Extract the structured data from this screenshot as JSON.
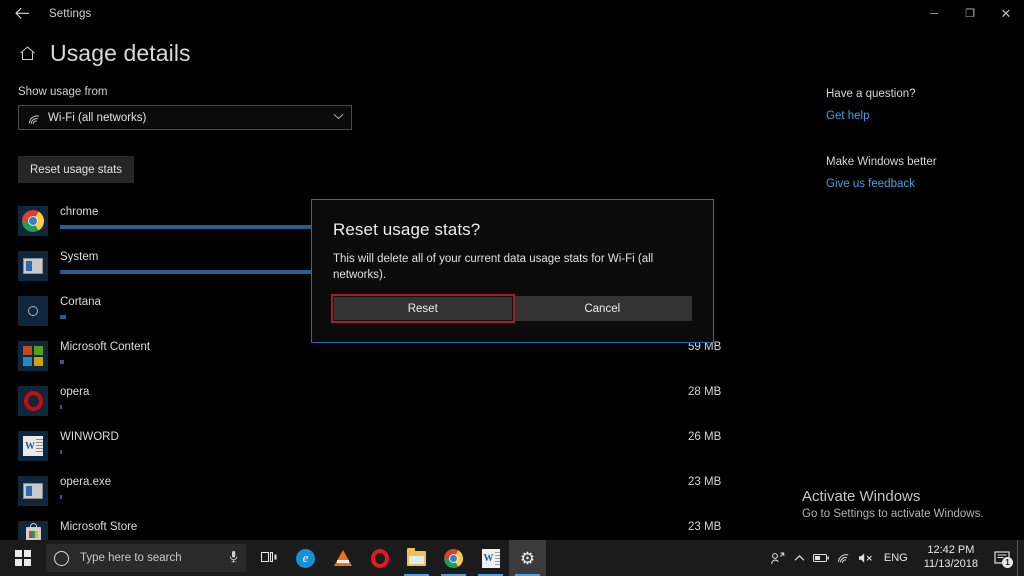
{
  "window": {
    "titlebar_title": "Settings",
    "back_icon": "back-arrow-icon",
    "minimize_label": "─",
    "maximize_label": "❐",
    "close_label": "✕"
  },
  "header": {
    "home_icon": "home-icon",
    "page_title": "Usage details"
  },
  "main": {
    "show_usage_label": "Show usage from",
    "network_select": {
      "value": "Wi-Fi (all networks)",
      "icon": "wifi-icon",
      "chevron": "⌄"
    },
    "reset_usage_stats_label": "Reset usage stats",
    "apps": [
      {
        "name": "chrome",
        "size": "",
        "bar_percent": 100,
        "icon": "chrome-icon"
      },
      {
        "name": "System",
        "size": "",
        "bar_percent": 45,
        "icon": "window-icon"
      },
      {
        "name": "Cortana",
        "size": "",
        "bar_percent": 1,
        "icon": "cortana-icon"
      },
      {
        "name": "Microsoft Content",
        "size": "59 MB",
        "bar_percent": 0.6,
        "icon": "microsoft-logo-icon"
      },
      {
        "name": "opera",
        "size": "28 MB",
        "bar_percent": 0.4,
        "icon": "opera-icon"
      },
      {
        "name": "WINWORD",
        "size": "26 MB",
        "bar_percent": 0.4,
        "icon": "word-icon"
      },
      {
        "name": "opera.exe",
        "size": "23 MB",
        "bar_percent": 0.4,
        "icon": "window-icon"
      },
      {
        "name": "Microsoft Store",
        "size": "23 MB",
        "bar_percent": 0.3,
        "icon": "store-icon"
      }
    ]
  },
  "rail": {
    "question_heading": "Have a question?",
    "get_help_link": "Get help",
    "feedback_heading": "Make Windows better",
    "feedback_link": "Give us feedback"
  },
  "watermark": {
    "title": "Activate Windows",
    "subtitle": "Go to Settings to activate Windows."
  },
  "dialog": {
    "title": "Reset usage stats?",
    "body": "This will delete all of your current data usage stats for Wi-Fi (all networks).",
    "primary_button": "Reset",
    "secondary_button": "Cancel",
    "border_color": "#1f6fb6",
    "focus_color": "#9d1f2b"
  },
  "taskbar": {
    "start_icon": "windows-start-icon",
    "search_placeholder": "Type here to search",
    "search_circle_icon": "cortana-circle-icon",
    "mic_icon": "microphone-icon",
    "task_view_icon": "task-view-icon",
    "apps": [
      {
        "name": "edge",
        "icon": "edge-icon",
        "running": false
      },
      {
        "name": "vlc",
        "icon": "vlc-cone-icon",
        "running": false
      },
      {
        "name": "opera",
        "icon": "opera-icon",
        "running": false
      },
      {
        "name": "file-explorer",
        "icon": "folder-icon",
        "running": true
      },
      {
        "name": "chrome",
        "icon": "chrome-icon",
        "running": true
      },
      {
        "name": "word",
        "icon": "word-icon",
        "running": true
      },
      {
        "name": "settings",
        "icon": "gear-icon",
        "running": true
      }
    ],
    "tray": {
      "people_icon": "people-icon",
      "chevron_icon": "show-hidden-icons-chevron",
      "battery_icon": "battery-icon",
      "wifi_icon": "wifi-icon",
      "volume_icon": "volume-muted-icon",
      "language": "ENG",
      "time": "12:42 PM",
      "date": "11/13/2018",
      "action_center_icon": "action-center-icon",
      "action_center_badge": "1"
    }
  }
}
